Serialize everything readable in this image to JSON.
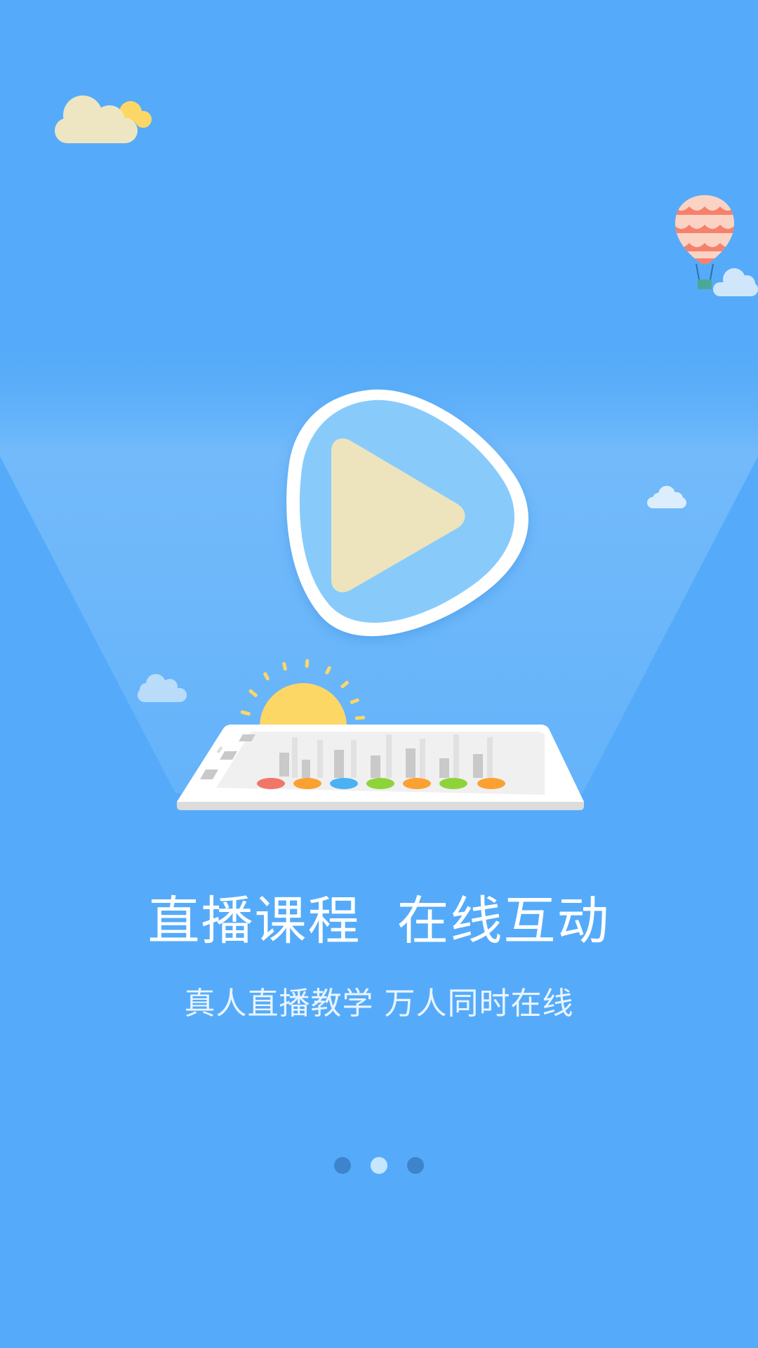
{
  "onboarding": {
    "title": "直播课程  在线互动",
    "subtitle": "真人直播教学 万人同时在线"
  },
  "pager": {
    "total": 3,
    "active_index": 1
  },
  "colors": {
    "background": "#55abf9",
    "play_button": "#88cbfb",
    "play_triangle": "#ede4bd",
    "sun": "#fcd766",
    "dot_inactive": "#3d84cc",
    "dot_active": "#c6e6ff"
  },
  "illustration": {
    "icons": [
      "cloud-icon",
      "hot-air-balloon-icon",
      "play-icon",
      "sun-icon",
      "tablet-icon"
    ]
  }
}
